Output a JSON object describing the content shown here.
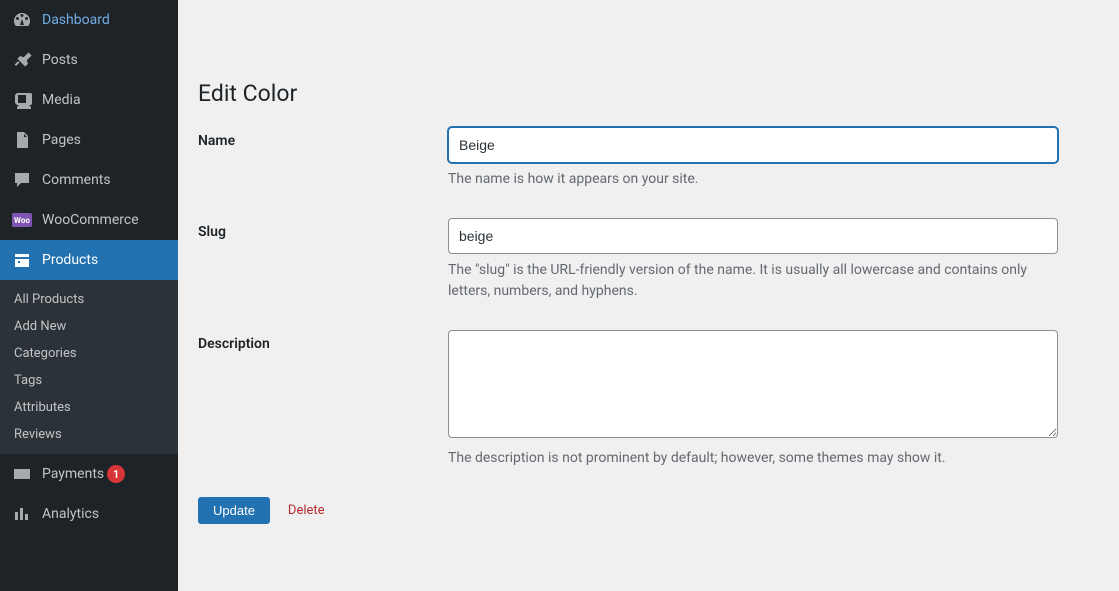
{
  "sidebar": {
    "items": [
      {
        "label": "Dashboard"
      },
      {
        "label": "Posts"
      },
      {
        "label": "Media"
      },
      {
        "label": "Pages"
      },
      {
        "label": "Comments"
      },
      {
        "label": "WooCommerce"
      },
      {
        "label": "Products"
      },
      {
        "label": "Payments",
        "badge": "1"
      },
      {
        "label": "Analytics"
      }
    ],
    "submenu": [
      {
        "label": "All Products"
      },
      {
        "label": "Add New"
      },
      {
        "label": "Categories"
      },
      {
        "label": "Tags"
      },
      {
        "label": "Attributes"
      },
      {
        "label": "Reviews"
      }
    ]
  },
  "page": {
    "title": "Edit Color"
  },
  "form": {
    "name": {
      "label": "Name",
      "value": "Beige",
      "help": "The name is how it appears on your site."
    },
    "slug": {
      "label": "Slug",
      "value": "beige",
      "help": "The \"slug\" is the URL-friendly version of the name. It is usually all lowercase and contains only letters, numbers, and hyphens."
    },
    "description": {
      "label": "Description",
      "value": "",
      "help": "The description is not prominent by default; however, some themes may show it."
    }
  },
  "actions": {
    "update": "Update",
    "delete": "Delete"
  }
}
